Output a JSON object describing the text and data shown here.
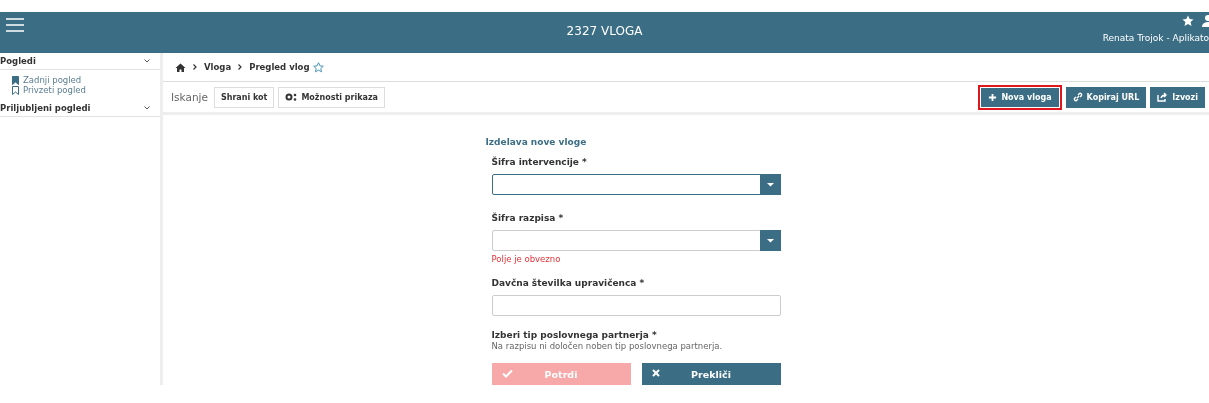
{
  "header": {
    "title": "2327 VLOGA",
    "user": "Renata Trojok - Aplikato"
  },
  "sidebar": {
    "sections": [
      {
        "title": "Pogledi",
        "expanded": true,
        "items": [
          {
            "label": "Zadnji pogled",
            "kind": "filled"
          },
          {
            "label": "Privzeti pogled",
            "kind": "outline"
          }
        ]
      },
      {
        "title": "Priljubljeni pogledi",
        "expanded": true
      }
    ]
  },
  "breadcrumb": [
    "Vloga",
    "Pregled vlog"
  ],
  "toolbar": {
    "search_label": "Iskanje",
    "left_buttons": [
      {
        "label": "Shrani kot",
        "kind": "plain"
      },
      {
        "label": "Možnosti prikaza",
        "kind": "options"
      }
    ],
    "right_buttons": [
      {
        "label": "Nova vloga",
        "kind": "add",
        "highlighted": true
      },
      {
        "label": "Kopiraj URL",
        "kind": "link",
        "highlighted": false
      },
      {
        "label": "Izvozi",
        "kind": "export",
        "highlighted": false
      }
    ]
  },
  "form": {
    "title": "Izdelava nove vloge",
    "fields": [
      {
        "label": "Šifra intervencije *",
        "kind": "select",
        "focused": true
      },
      {
        "label": "Šifra razpisa *",
        "kind": "select",
        "focused": false,
        "error": "Polje je obvezno"
      },
      {
        "label": "Davčna številka upravičenca *",
        "kind": "text",
        "focused": false
      },
      {
        "label": "Izberi tip poslovnega partnerja *",
        "kind": "note",
        "note": "Na razpisu ni določen noben tip poslovnega partnerja."
      }
    ],
    "buttons": [
      {
        "label": "Potrdi",
        "kind": "confirm",
        "disabled": true
      },
      {
        "label": "Prekliči",
        "kind": "cancel",
        "disabled": false
      }
    ]
  }
}
